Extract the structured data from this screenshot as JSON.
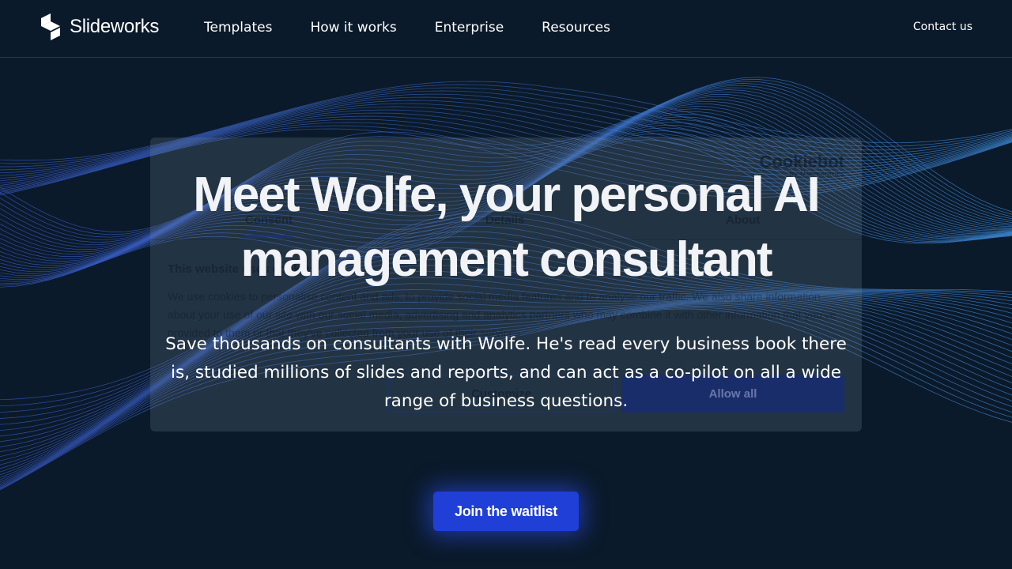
{
  "header": {
    "brand": "Slideworks",
    "nav": [
      {
        "label": "Templates"
      },
      {
        "label": "How it works"
      },
      {
        "label": "Enterprise"
      },
      {
        "label": "Resources"
      }
    ],
    "contact_label": "Contact us"
  },
  "cookie_dialog": {
    "brand_name": "Cookiebot",
    "brand_sub": "by Usercentrics",
    "tabs": [
      "Consent",
      "Details",
      "About"
    ],
    "title": "This website uses cookies",
    "text": "We use cookies to personalise content and ads, to provide social media features and to analyse our traffic. We also share information about your use of our site with our social media, advertising and analytics partners who may combine it with other information that you've provided to them or that they've collected from your use of their services.",
    "customize_label": "Customize",
    "allow_label": "Allow all"
  },
  "hero": {
    "title_line1": "Meet Wolfe, your personal AI",
    "title_line2": "management consultant",
    "subtitle": "Save thousands on consultants with Wolfe. He's read every business book there is, studied millions of slides and reports, and can act as a co-pilot on all a wide range of business questions.",
    "cta_label": "Join the waitlist"
  },
  "colors": {
    "background": "#0b1a2a",
    "cta": "#1f3fd6",
    "wave": "#3b6fd8"
  }
}
